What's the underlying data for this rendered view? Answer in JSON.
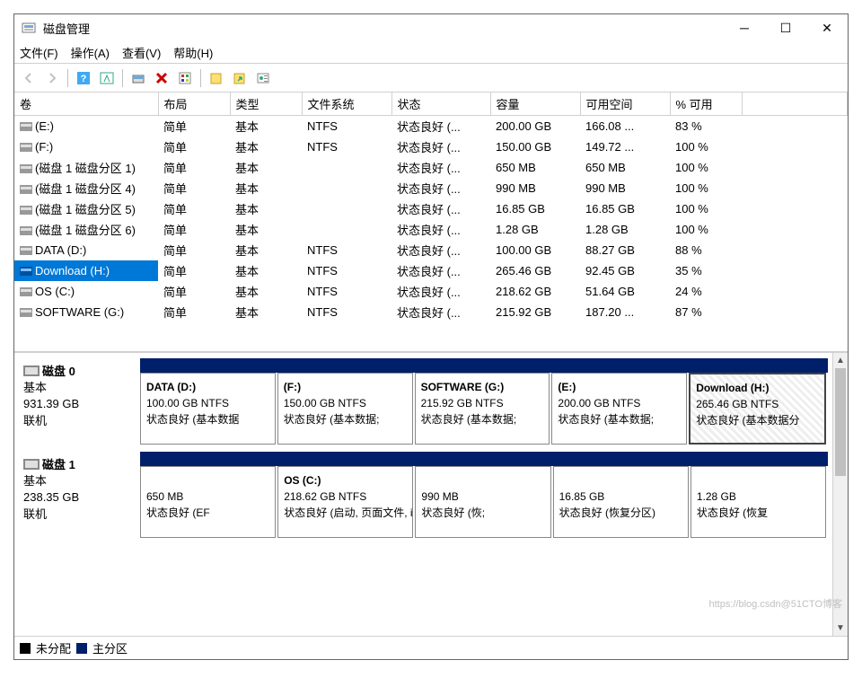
{
  "window": {
    "title": "磁盘管理"
  },
  "menu": {
    "file": "文件(F)",
    "action": "操作(A)",
    "view": "查看(V)",
    "help": "帮助(H)"
  },
  "cols": [
    "卷",
    "布局",
    "类型",
    "文件系统",
    "状态",
    "容量",
    "可用空间",
    "% 可用"
  ],
  "volumes": [
    {
      "name": "(E:)",
      "layout": "简单",
      "type": "基本",
      "fs": "NTFS",
      "status": "状态良好 (...",
      "cap": "200.00 GB",
      "free": "166.08 ...",
      "pct": "83 %",
      "sel": false
    },
    {
      "name": "(F:)",
      "layout": "简单",
      "type": "基本",
      "fs": "NTFS",
      "status": "状态良好 (...",
      "cap": "150.00 GB",
      "free": "149.72 ...",
      "pct": "100 %",
      "sel": false
    },
    {
      "name": "(磁盘 1 磁盘分区 1)",
      "layout": "简单",
      "type": "基本",
      "fs": "",
      "status": "状态良好 (...",
      "cap": "650 MB",
      "free": "650 MB",
      "pct": "100 %",
      "sel": false
    },
    {
      "name": "(磁盘 1 磁盘分区 4)",
      "layout": "简单",
      "type": "基本",
      "fs": "",
      "status": "状态良好 (...",
      "cap": "990 MB",
      "free": "990 MB",
      "pct": "100 %",
      "sel": false
    },
    {
      "name": "(磁盘 1 磁盘分区 5)",
      "layout": "简单",
      "type": "基本",
      "fs": "",
      "status": "状态良好 (...",
      "cap": "16.85 GB",
      "free": "16.85 GB",
      "pct": "100 %",
      "sel": false
    },
    {
      "name": "(磁盘 1 磁盘分区 6)",
      "layout": "简单",
      "type": "基本",
      "fs": "",
      "status": "状态良好 (...",
      "cap": "1.28 GB",
      "free": "1.28 GB",
      "pct": "100 %",
      "sel": false
    },
    {
      "name": "DATA (D:)",
      "layout": "简单",
      "type": "基本",
      "fs": "NTFS",
      "status": "状态良好 (...",
      "cap": "100.00 GB",
      "free": "88.27 GB",
      "pct": "88 %",
      "sel": false
    },
    {
      "name": "Download (H:)",
      "layout": "简单",
      "type": "基本",
      "fs": "NTFS",
      "status": "状态良好 (...",
      "cap": "265.46 GB",
      "free": "92.45 GB",
      "pct": "35 %",
      "sel": true
    },
    {
      "name": "OS (C:)",
      "layout": "简单",
      "type": "基本",
      "fs": "NTFS",
      "status": "状态良好 (...",
      "cap": "218.62 GB",
      "free": "51.64 GB",
      "pct": "24 %",
      "sel": false
    },
    {
      "name": "SOFTWARE (G:)",
      "layout": "简单",
      "type": "基本",
      "fs": "NTFS",
      "status": "状态良好 (...",
      "cap": "215.92 GB",
      "free": "187.20 ...",
      "pct": "87 %",
      "sel": false
    }
  ],
  "disks": [
    {
      "label": "磁盘 0",
      "type": "基本",
      "size": "931.39 GB",
      "state": "联机",
      "parts": [
        {
          "name": "DATA  (D:)",
          "line2": "100.00 GB NTFS",
          "line3": "状态良好 (基本数据",
          "sel": false
        },
        {
          "name": "(F:)",
          "line2": "150.00 GB NTFS",
          "line3": "状态良好 (基本数据;",
          "sel": false
        },
        {
          "name": "SOFTWARE  (G:)",
          "line2": "215.92 GB NTFS",
          "line3": "状态良好 (基本数据;",
          "sel": false
        },
        {
          "name": "(E:)",
          "line2": "200.00 GB NTFS",
          "line3": "状态良好 (基本数据;",
          "sel": false
        },
        {
          "name": "Download  (H:)",
          "line2": "265.46 GB NTFS",
          "line3": "状态良好 (基本数据分",
          "sel": true
        }
      ]
    },
    {
      "label": "磁盘 1",
      "type": "基本",
      "size": "238.35 GB",
      "state": "联机",
      "parts": [
        {
          "name": "",
          "line2": "650 MB",
          "line3": "状态良好 (EF",
          "sel": false
        },
        {
          "name": "OS  (C:)",
          "line2": "218.62 GB NTFS",
          "line3": "状态良好 (启动, 页面文件, i",
          "sel": false
        },
        {
          "name": "",
          "line2": "990 MB",
          "line3": "状态良好 (恢;",
          "sel": false
        },
        {
          "name": "",
          "line2": "16.85 GB",
          "line3": "状态良好 (恢复分区)",
          "sel": false
        },
        {
          "name": "",
          "line2": "1.28 GB",
          "line3": "状态良好 (恢复",
          "sel": false
        }
      ]
    }
  ],
  "legend": {
    "unalloc": "未分配",
    "primary": "主分区"
  },
  "watermark": "https://blog.csdn@51CTO博客"
}
